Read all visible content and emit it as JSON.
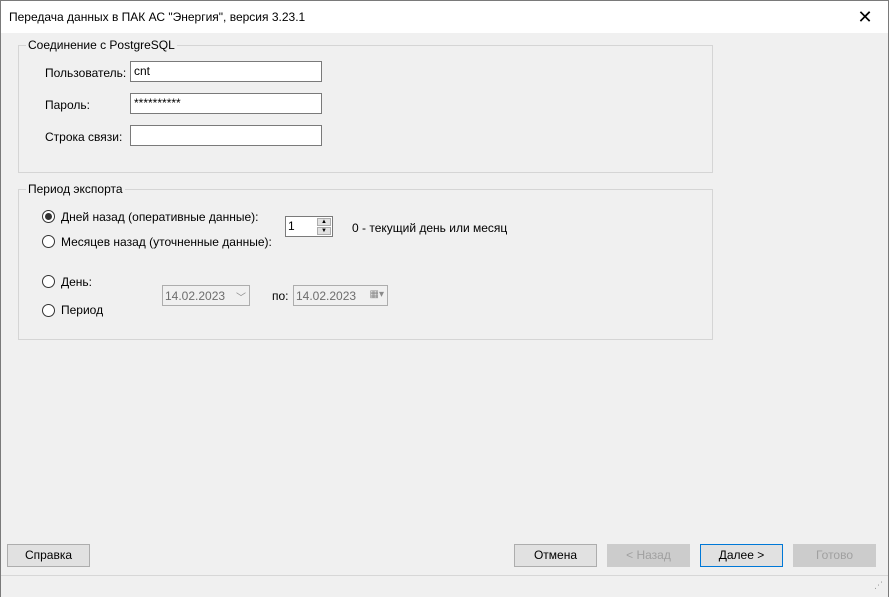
{
  "window": {
    "title": "Передача данных в ПАК АС \"Энергия\", версия 3.23.1",
    "close_glyph": "✕"
  },
  "connection": {
    "legend": "Соединение с PostgreSQL",
    "user_label": "Пользователь:",
    "user_value": "cnt",
    "password_label": "Пароль:",
    "password_value": "**********",
    "connstr_label": "Строка связи:",
    "connstr_value": ""
  },
  "export": {
    "legend": "Период экспорта",
    "days_back_label": "Дней назад (оперативные данные):",
    "days_back_selected": true,
    "months_back_label": "Месяцев назад (уточненные данные):",
    "spin_value": "1",
    "spin_hint": "0 - текущий день или месяц",
    "day_label": "День:",
    "period_label": "Период",
    "date_from": "14.02.2023",
    "to_label": "по:",
    "date_to": "14.02.2023"
  },
  "buttons": {
    "help": "Справка",
    "cancel": "Отмена",
    "back": "< Назад",
    "next": "Далее >",
    "finish": "Готово"
  }
}
